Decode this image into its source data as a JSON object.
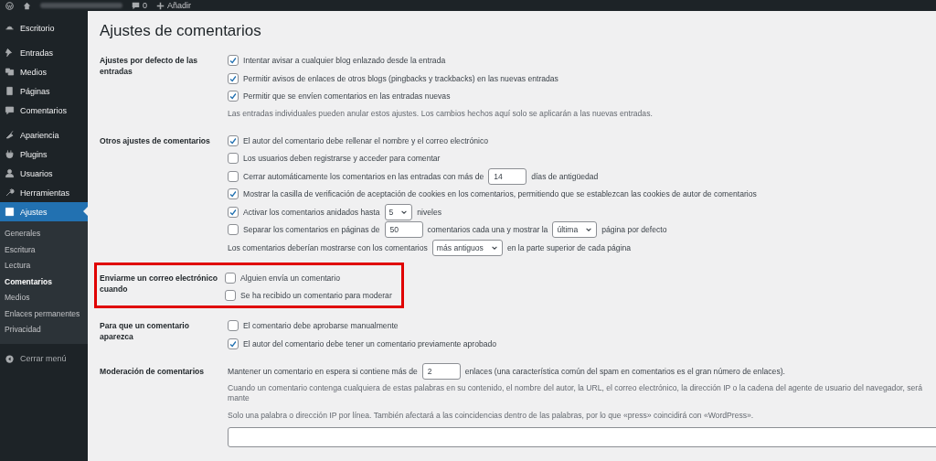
{
  "top_bar": {
    "comments": "0",
    "add": "Añadir"
  },
  "sidebar": {
    "groups": [
      [
        {
          "label": "Escritorio",
          "selected": false
        }
      ],
      [
        {
          "label": "Entradas",
          "selected": false
        },
        {
          "label": "Medios",
          "selected": false
        },
        {
          "label": "Páginas",
          "selected": false
        },
        {
          "label": "Comentarios",
          "selected": false
        }
      ],
      [
        {
          "label": "Apariencia",
          "selected": false
        },
        {
          "label": "Plugins",
          "selected": false
        },
        {
          "label": "Usuarios",
          "selected": false
        },
        {
          "label": "Herramientas",
          "selected": false
        },
        {
          "label": "Ajustes",
          "selected": true,
          "children": [
            {
              "label": "Generales",
              "selected": false
            },
            {
              "label": "Escritura",
              "selected": false
            },
            {
              "label": "Lectura",
              "selected": false
            },
            {
              "label": "Comentarios",
              "selected": true
            },
            {
              "label": "Medios",
              "selected": false
            },
            {
              "label": "Enlaces permanentes",
              "selected": false
            },
            {
              "label": "Privacidad",
              "selected": false
            }
          ]
        }
      ]
    ],
    "collapse": "Cerrar menú"
  },
  "page_title": "Ajustes de comentarios",
  "sections": [
    {
      "label": "Ajustes por defecto de las entradas",
      "highlighted": false,
      "lines": [
        {
          "kind": "option",
          "checked": true,
          "parts": [
            {
              "kind": "text",
              "text": "Intentar avisar a cualquier blog enlazado desde la entrada"
            }
          ]
        },
        {
          "kind": "option",
          "checked": true,
          "parts": [
            {
              "kind": "text",
              "text": "Permitir avisos de enlaces de otros blogs (pingbacks y trackbacks) en las nuevas entradas"
            }
          ]
        },
        {
          "kind": "option",
          "checked": true,
          "parts": [
            {
              "kind": "text",
              "text": "Permitir que se envíen comentarios en las entradas nuevas"
            }
          ]
        },
        {
          "kind": "note",
          "text": "Las entradas individuales pueden anular estos ajustes. Los cambios hechos aquí solo se aplicarán a las nuevas entradas."
        }
      ]
    },
    {
      "label": "Otros ajustes de comentarios",
      "highlighted": false,
      "lines": [
        {
          "kind": "option",
          "checked": true,
          "parts": [
            {
              "kind": "text",
              "text": "El autor del comentario debe rellenar el nombre y el correo electrónico"
            }
          ]
        },
        {
          "kind": "option",
          "checked": false,
          "parts": [
            {
              "kind": "text",
              "text": "Los usuarios deben registrarse y acceder para comentar"
            }
          ]
        },
        {
          "kind": "option",
          "checked": false,
          "parts": [
            {
              "kind": "text",
              "text": "Cerrar automáticamente los comentarios en las entradas con más de"
            },
            {
              "kind": "input",
              "value": "14"
            },
            {
              "kind": "text",
              "text": "días de antigüedad"
            }
          ]
        },
        {
          "kind": "option",
          "checked": true,
          "parts": [
            {
              "kind": "text",
              "text": "Mostrar la casilla de verificación de aceptación de cookies en los comentarios, permitiendo que se establezcan las cookies de autor de comentarios"
            }
          ]
        },
        {
          "kind": "option",
          "checked": true,
          "parts": [
            {
              "kind": "text",
              "text": "Activar los comentarios anidados hasta"
            },
            {
              "kind": "select",
              "value": "5"
            },
            {
              "kind": "text",
              "text": "niveles"
            }
          ]
        },
        {
          "kind": "option",
          "checked": false,
          "parts": [
            {
              "kind": "text",
              "text": "Separar los comentarios en páginas de"
            },
            {
              "kind": "input",
              "value": "50"
            },
            {
              "kind": "text",
              "text": "comentarios cada una y mostrar la"
            },
            {
              "kind": "select",
              "value": "última"
            },
            {
              "kind": "text",
              "text": "página por defecto"
            }
          ]
        },
        {
          "kind": "plain",
          "parts": [
            {
              "kind": "text",
              "text": "Los comentarios deberían mostrarse con los comentarios"
            },
            {
              "kind": "select",
              "value": "más antiguos"
            },
            {
              "kind": "text",
              "text": "en la parte superior de cada página"
            }
          ]
        }
      ]
    },
    {
      "label": "Enviarme un correo electrónico cuando",
      "highlighted": true,
      "lines": [
        {
          "kind": "option",
          "checked": false,
          "parts": [
            {
              "kind": "text",
              "text": "Alguien envía un comentario"
            }
          ]
        },
        {
          "kind": "option",
          "checked": false,
          "parts": [
            {
              "kind": "text",
              "text": "Se ha recibido un comentario para moderar"
            }
          ]
        }
      ]
    },
    {
      "label": "Para que un comentario aparezca",
      "highlighted": false,
      "lines": [
        {
          "kind": "option",
          "checked": false,
          "parts": [
            {
              "kind": "text",
              "text": "El comentario debe aprobarse manualmente"
            }
          ]
        },
        {
          "kind": "option",
          "checked": true,
          "parts": [
            {
              "kind": "text",
              "text": "El autor del comentario debe tener un comentario previamente aprobado"
            }
          ]
        }
      ]
    },
    {
      "label": "Moderación de comentarios",
      "highlighted": false,
      "lines": [
        {
          "kind": "plain",
          "parts": [
            {
              "kind": "text",
              "text": "Mantener un comentario en espera si contiene más de"
            },
            {
              "kind": "input",
              "value": "2"
            },
            {
              "kind": "text",
              "text": "enlaces (una característica común del spam en comentarios es el gran número de enlaces)."
            }
          ]
        },
        {
          "kind": "note",
          "text": "Cuando un comentario contenga cualquiera de estas palabras en su contenido, el nombre del autor, la URL, el correo electrónico, la dirección IP o la cadena del agente de usuario del navegador, será mante"
        },
        {
          "kind": "note",
          "text": "Solo una palabra o dirección IP por línea. También afectará a las coincidencias dentro de las palabras, por lo que «press» coincidirá con «WordPress»."
        },
        {
          "kind": "textarea"
        }
      ]
    }
  ]
}
